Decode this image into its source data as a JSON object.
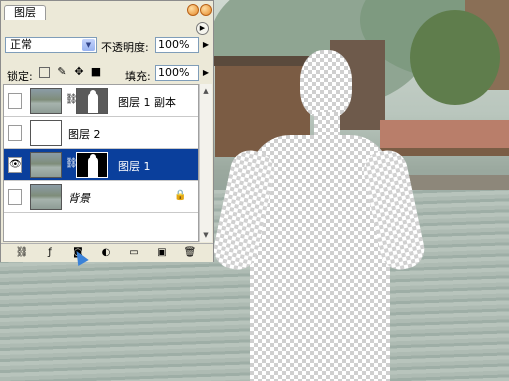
{
  "panel": {
    "tab_label": "图层",
    "blend_mode": "正常",
    "opacity_label": "不透明度:",
    "opacity_value": "100%",
    "lock_label": "锁定:",
    "fill_label": "填充:",
    "fill_value": "100%",
    "menu_icon": "panel-menu-arrow-icon"
  },
  "layers": [
    {
      "name": "图层 1 副本",
      "visible": false,
      "selected": false,
      "thumb": "photo",
      "has_mask": true
    },
    {
      "name": "图层 2",
      "visible": false,
      "selected": false,
      "thumb": "blank",
      "has_mask": false
    },
    {
      "name": "图层 1",
      "visible": true,
      "selected": true,
      "thumb": "photo",
      "has_mask": true
    },
    {
      "name": "背景",
      "visible": false,
      "selected": false,
      "thumb": "photo",
      "has_mask": false,
      "locked": true
    }
  ],
  "bottom_icons": [
    "link-layers-icon",
    "layer-style-icon",
    "add-mask-icon",
    "adjustment-layer-icon",
    "new-group-icon",
    "new-layer-icon",
    "trash-icon"
  ],
  "colors": {
    "selected_row": "#0a3f9c",
    "panel_bg": "#ece9d8"
  }
}
